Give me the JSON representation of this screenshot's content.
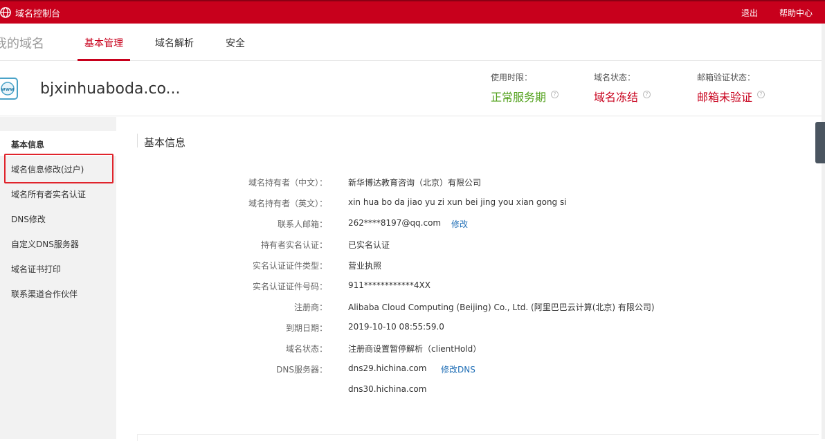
{
  "topbar": {
    "brand": "域名控制台",
    "logout": "退出",
    "help": "帮助中心"
  },
  "nav": {
    "my_domains": "我的域名",
    "tabs": [
      {
        "label": "基本管理",
        "active": true
      },
      {
        "label": "域名解析",
        "active": false
      },
      {
        "label": "安全",
        "active": false
      }
    ]
  },
  "domain": {
    "name": "bjxinhuaboda.co...",
    "icon": "www-globe-icon",
    "stats": [
      {
        "label": "使用时限：",
        "value": "正常服务期",
        "color": "#52a11c"
      },
      {
        "label": "域名状态：",
        "value": "域名冻结",
        "color": "#c8001c"
      },
      {
        "label": "邮箱验证状态：",
        "value": "邮箱未验证",
        "color": "#c8001c"
      }
    ]
  },
  "sidebar": {
    "items": [
      {
        "label": "基本信息",
        "bold": true
      },
      {
        "label": "域名信息修改(过户)",
        "highlighted": true
      },
      {
        "label": "域名所有者实名认证"
      },
      {
        "label": "DNS修改"
      },
      {
        "label": "自定义DNS服务器"
      },
      {
        "label": "域名证书打印"
      },
      {
        "label": "联系渠道合作伙伴"
      }
    ]
  },
  "main": {
    "title": "基本信息",
    "rows": [
      {
        "key": "域名持有者（中文）：",
        "value": "新华博达教育咨询（北京）有限公司"
      },
      {
        "key": "域名持有者（英文）：",
        "value": "xin hua bo da jiao yu zi xun bei jing you xian gong si"
      },
      {
        "key": "联系人邮箱：",
        "value": "262****8197@qq.com",
        "link": "修改"
      },
      {
        "key": "持有者实名认证：",
        "value": "已实名认证"
      },
      {
        "key": "实名认证证件类型：",
        "value": "营业执照"
      },
      {
        "key": "实名认证证件号码：",
        "value": "911************4XX"
      },
      {
        "key": "注册商：",
        "value": "Alibaba Cloud Computing (Beijing) Co., Ltd. (阿里巴巴云计算(北京) 有限公司)"
      },
      {
        "key": "到期日期：",
        "value": "2019-10-10 08:55:59.0"
      },
      {
        "key": "域名状态：",
        "value": "注册商设置暂停解析（clientHold）"
      },
      {
        "key": "DNS服务器：",
        "value": "dns29.hichina.com",
        "link": "修改DNS"
      },
      {
        "key": "",
        "value": "dns30.hichina.com"
      }
    ]
  },
  "colors": {
    "brand_red": "#c8001c",
    "link_blue": "#1f6eb6",
    "ok_green": "#52a11c"
  }
}
